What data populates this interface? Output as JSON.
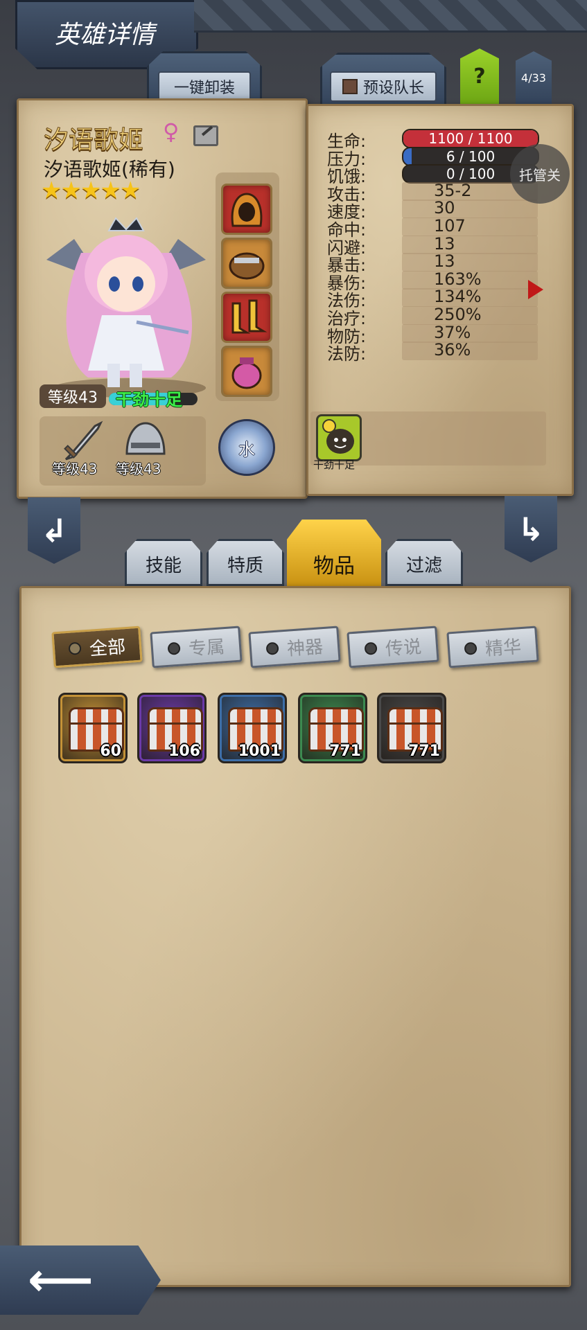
{
  "header": {
    "title": "英雄详情"
  },
  "top_buttons": {
    "unequip_all": "一键卸装",
    "preset_leader": "预设队长",
    "help": "?",
    "page_counter": "4/33"
  },
  "hero": {
    "name": "汐语歌姬",
    "gender_symbol": "♀",
    "subtitle": "汐语歌姬(稀有)",
    "stars": 5,
    "level_label": "等级43",
    "mood": "干劲十足",
    "element": "水",
    "weapon_level": "等级43",
    "armor_level": "等级43"
  },
  "stats": [
    {
      "label": "生命:",
      "value": "1100 / 1100",
      "kind": "bar",
      "fraction": 1.0,
      "color": "#c4303a"
    },
    {
      "label": "压力:",
      "value": "6 / 100",
      "kind": "bar",
      "fraction": 0.06,
      "color": "#3a6cc4"
    },
    {
      "label": "饥饿:",
      "value": "0 / 100",
      "kind": "bar",
      "fraction": 0.0,
      "color": "#3a6cc4"
    },
    {
      "label": "攻击:",
      "value": "35-2"
    },
    {
      "label": "速度:",
      "value": "30"
    },
    {
      "label": "命中:",
      "value": "107"
    },
    {
      "label": "闪避:",
      "value": "13"
    },
    {
      "label": "暴击:",
      "value": "13"
    },
    {
      "label": "暴伤:",
      "value": "163%"
    },
    {
      "label": "法伤:",
      "value": "134%"
    },
    {
      "label": "治疗:",
      "value": "250%"
    },
    {
      "label": "物防:",
      "value": "37%"
    },
    {
      "label": "法防:",
      "value": "36%"
    }
  ],
  "overlay_button": "托管关",
  "trait_badge": "干劲十足",
  "tabs": {
    "skills": "技能",
    "traits": "特质",
    "items": "物品",
    "filter": "过滤",
    "active": "物品"
  },
  "filters": [
    "全部",
    "专属",
    "神器",
    "传说",
    "精华"
  ],
  "active_filter": "全部",
  "chests": [
    {
      "count": "60",
      "frame": "#c49237"
    },
    {
      "count": "106",
      "frame": "#6b3aa8"
    },
    {
      "count": "1001",
      "frame": "#3d6ea8"
    },
    {
      "count": "771",
      "frame": "#3c8a50"
    },
    {
      "count": "771",
      "frame": "#4a4a4a"
    }
  ]
}
